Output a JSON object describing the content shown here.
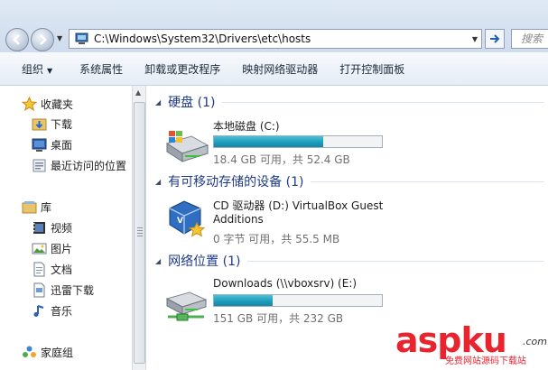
{
  "address": {
    "path": "C:\\Windows\\System32\\Drivers\\etc\\hosts",
    "search_placeholder": "搜索"
  },
  "toolbar": {
    "items": [
      "组织",
      "系统属性",
      "卸载或更改程序",
      "映射网络驱动器",
      "打开控制面板"
    ]
  },
  "nav": {
    "favorites": "收藏夹",
    "downloads": "下载",
    "desktop": "桌面",
    "recent": "最近访问的位置",
    "libraries": "库",
    "videos": "视频",
    "pictures": "图片",
    "documents": "文档",
    "thunder": "迅雷下载",
    "music": "音乐",
    "homegroup": "家庭组"
  },
  "groups": {
    "hdd": "硬盘 (1)",
    "removable": "有可移动存储的设备 (1)",
    "network": "网络位置 (1)"
  },
  "drives": {
    "c": {
      "name": "本地磁盘 (C:)",
      "size": "18.4 GB 可用，共 52.4 GB",
      "used_fraction": 0.65
    },
    "d": {
      "name": "CD 驱动器 (D:) VirtualBox Guest",
      "name2": "Additions",
      "size": "0 字节 可用，共 55.5 MB"
    },
    "e": {
      "name": "Downloads (\\\\vboxsrv) (E:)",
      "size": "151 GB 可用，共 232 GB",
      "used_fraction": 0.35
    }
  },
  "watermark": {
    "brand": "aspku",
    "com": ".com",
    "slogan": "免费网站源码下载站"
  }
}
